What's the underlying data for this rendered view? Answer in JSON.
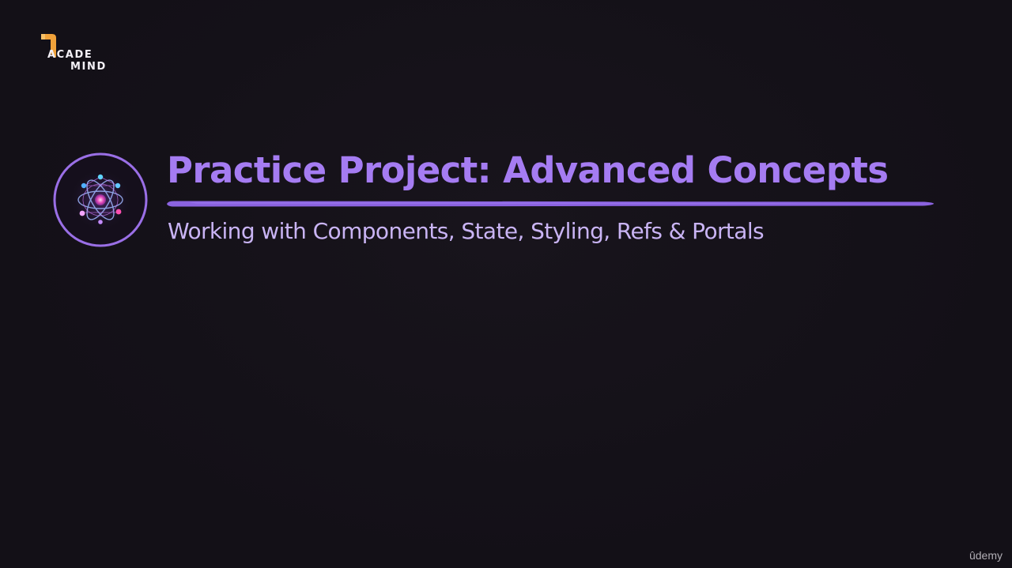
{
  "logo": {
    "line1": "ACADE",
    "line2": "MIND",
    "mark_color": "#f0a23a"
  },
  "slide": {
    "icon": "react-atom-icon",
    "title": "Practice Project: Advanced Concepts",
    "subtitle": "Working with Components, State, Styling, Refs & Portals",
    "title_color": "#a57cf2",
    "subtitle_color": "#c9b4f4",
    "underline_color": "#8b63e0"
  },
  "watermark": {
    "text": "ûdemy"
  },
  "colors": {
    "background": "#131017",
    "accent": "#a57cf2"
  }
}
